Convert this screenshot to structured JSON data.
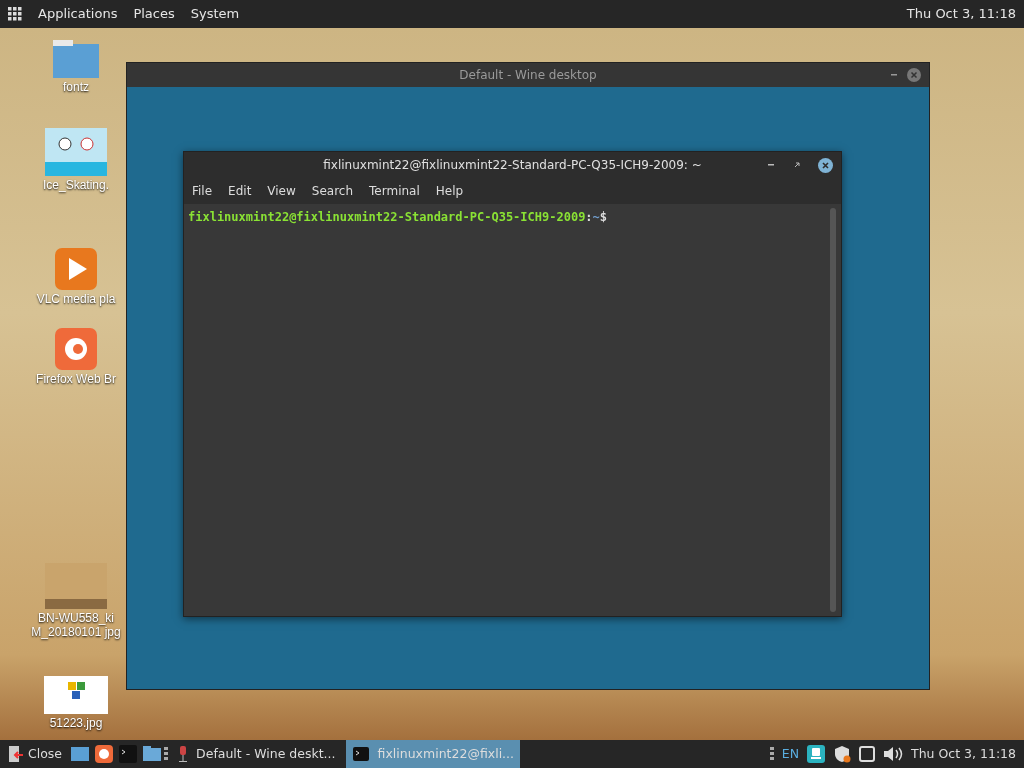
{
  "top_panel": {
    "menus": [
      "Applications",
      "Places",
      "System"
    ],
    "clock": "Thu Oct 3, 11:18"
  },
  "desktop_icons": [
    {
      "kind": "folder",
      "label": "fontz"
    },
    {
      "kind": "image",
      "label": "Ice_Skating."
    },
    {
      "kind": "vlc",
      "label": "VLC media pla"
    },
    {
      "kind": "firefox",
      "label": "Firefox Web Br"
    },
    {
      "kind": "photo",
      "label": "BN-WU558_ki M_20180101 jpg"
    },
    {
      "kind": "logo",
      "label": "51223.jpg"
    }
  ],
  "wine_window": {
    "title": "Default - Wine desktop"
  },
  "terminal": {
    "title": "fixlinuxmint22@fixlinuxmint22-Standard-PC-Q35-ICH9-2009: ~",
    "menu": [
      "File",
      "Edit",
      "View",
      "Search",
      "Terminal",
      "Help"
    ],
    "prompt": {
      "user_host": "fixlinuxmint22@fixlinuxmint22-Standard-PC-Q35-ICH9-2009",
      "separator": ":",
      "path": "~",
      "symbol": "$"
    }
  },
  "taskbar": {
    "close_label": "Close",
    "launchers": [
      {
        "kind": "desktop"
      },
      {
        "kind": "firefox"
      },
      {
        "kind": "terminal"
      },
      {
        "kind": "files"
      }
    ],
    "tasks": [
      {
        "kind": "wine",
        "label": "Default - Wine deskt...",
        "selected": false
      },
      {
        "kind": "terminal",
        "label": "fixlinuxmint22@fixli...",
        "selected": true
      }
    ],
    "language": "EN",
    "clock": "Thu Oct 3, 11:18"
  }
}
